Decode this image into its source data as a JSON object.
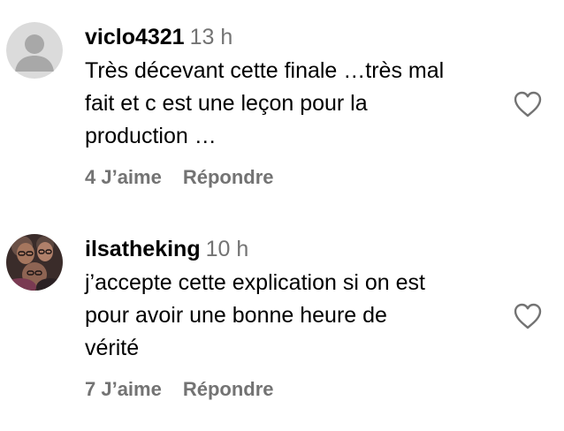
{
  "comments": [
    {
      "username": "viclo4321",
      "time": "13 h",
      "text_lines": [
        "Très décevant cette finale …très mal",
        "fait et c est une leçon pour la",
        "production …"
      ],
      "likes_label": "4 J’aime",
      "reply_label": "Répondre",
      "avatar": "default-avatar-icon"
    },
    {
      "username": "ilsatheking",
      "time": "10 h",
      "text_lines": [
        "j’accepte cette explication si on est",
        "pour avoir une bonne heure de",
        "vérité"
      ],
      "likes_label": "7 J’aime",
      "reply_label": "Répondre",
      "avatar": "profile-photo"
    }
  ],
  "colors": {
    "text": "#000000",
    "secondary": "#737373",
    "heart_stroke": "#737373",
    "default_avatar_bg": "#dbdbdb",
    "default_avatar_fg": "#a8a8a8"
  },
  "icons": {
    "like": "heart-outline-icon"
  }
}
